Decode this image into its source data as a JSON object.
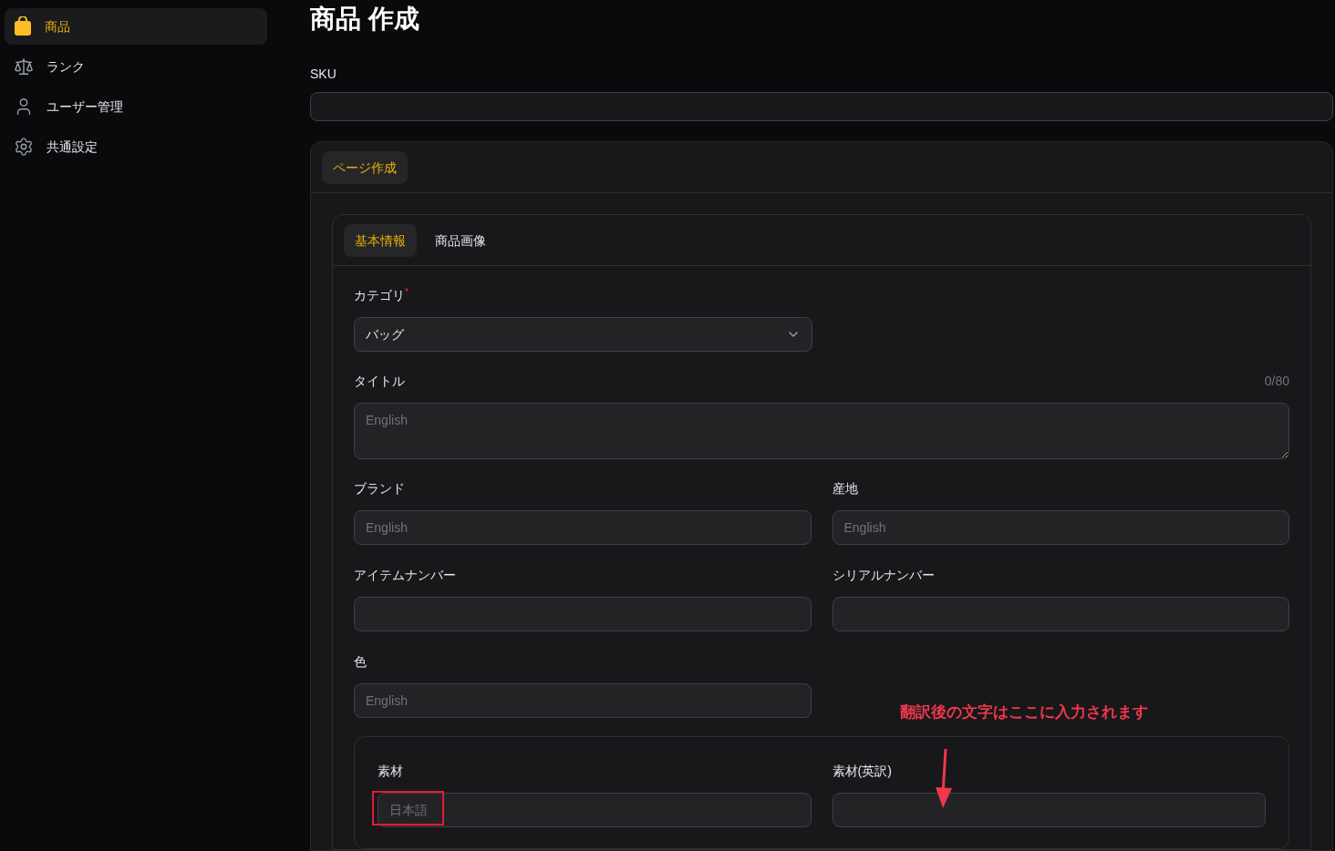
{
  "sidebar": {
    "items": [
      {
        "label": "商品",
        "selected": true
      },
      {
        "label": "ランク",
        "selected": false
      },
      {
        "label": "ユーザー管理",
        "selected": false
      },
      {
        "label": "共通設定",
        "selected": false
      }
    ]
  },
  "page": {
    "title": "商品 作成"
  },
  "sku": {
    "label": "SKU"
  },
  "outer_tabs": [
    {
      "label": "ページ作成",
      "selected": true
    }
  ],
  "inner_tabs": [
    {
      "label": "基本情報",
      "selected": true
    },
    {
      "label": "商品画像",
      "selected": false
    }
  ],
  "category": {
    "label": "カテゴリ",
    "required_mark": "*",
    "value": "バッグ"
  },
  "title_field": {
    "label": "タイトル",
    "counter": "0/80",
    "placeholder": "English"
  },
  "fields": [
    {
      "label": "ブランド",
      "placeholder": "English"
    },
    {
      "label": "産地",
      "placeholder": "English"
    },
    {
      "label": "アイテムナンバー"
    },
    {
      "label": "シリアルナンバー"
    },
    {
      "label": "色",
      "placeholder": "English"
    }
  ],
  "annotation": "翻訳後の文字はここに入力されます",
  "material": [
    {
      "label": "素材",
      "placeholder": "日本語",
      "highlighted": true
    },
    {
      "label": "素材(英訳)",
      "highlighted": false
    }
  ]
}
